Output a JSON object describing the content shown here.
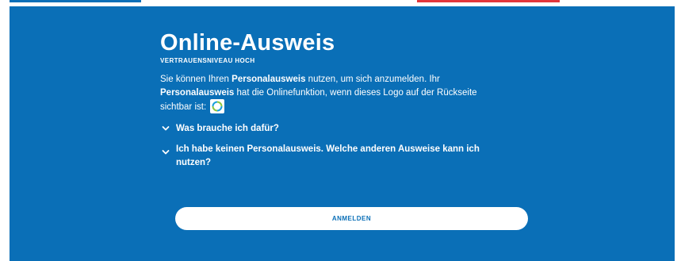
{
  "card": {
    "title": "Online-Ausweis",
    "trust_level": "VERTRAUENSNIVEAU HOCH",
    "description": {
      "part1": "Sie können Ihren ",
      "bold1": "Personalausweis",
      "part2": " nutzen, um sich anzumelden. Ihr ",
      "bold2": "Personalausweis",
      "part3": " hat die Onlinefunktion, wenn dieses Logo auf der Rückseite sichtbar ist:"
    },
    "logo_icon": "eid-logo-icon",
    "accordion": [
      {
        "label": "Was brauche ich dafür?",
        "icon": "chevron-down-icon"
      },
      {
        "label": "Ich habe keinen Personalausweis. Welche anderen Ausweise kann ich nutzen?",
        "icon": "chevron-down-icon"
      }
    ],
    "login_button": "ANMELDEN"
  },
  "colors": {
    "panel_background": "#0a6fb7",
    "text": "#ffffff",
    "button_background": "#ffffff",
    "button_text": "#0a6fb7",
    "top_strip_blue": "#0b6fb8",
    "top_strip_red": "#e2363c"
  }
}
